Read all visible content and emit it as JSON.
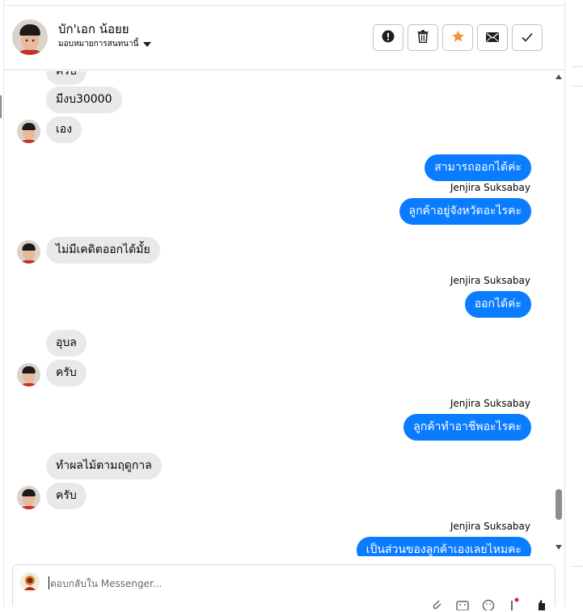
{
  "header": {
    "contact_name": "บัก'เอก น้อยย",
    "assign_label": "มอบหมายการสนทนานี้",
    "actions": [
      {
        "name": "mark-spam",
        "icon": "alert-circle-icon"
      },
      {
        "name": "delete",
        "icon": "trash-icon"
      },
      {
        "name": "star",
        "icon": "star-icon",
        "color": "#f7923a"
      },
      {
        "name": "mark-unread",
        "icon": "envelope-icon"
      },
      {
        "name": "mark-done",
        "icon": "check-icon"
      }
    ]
  },
  "messages": [
    {
      "dir": "in",
      "text": "ครับ"
    },
    {
      "dir": "in",
      "text": "มีงบ30000"
    },
    {
      "dir": "in",
      "text": "เอง"
    },
    {
      "dir": "out",
      "text": "สามารถออกได้ค่ะ"
    },
    {
      "dir": "out",
      "sender": "Jenjira Suksabay",
      "text": "ลูกค้าอยู่จังหวัดอะไรคะ"
    },
    {
      "dir": "in",
      "text": "ไม่มีเคดิตออกได้มั้ย"
    },
    {
      "dir": "out",
      "sender": "Jenjira Suksabay",
      "text": "ออกได้ค่ะ"
    },
    {
      "dir": "in",
      "text": "อุบล"
    },
    {
      "dir": "in",
      "text": "ครับ"
    },
    {
      "dir": "out",
      "sender": "Jenjira Suksabay",
      "text": "ลูกค้าทำอาชีพอะไรคะ"
    },
    {
      "dir": "in",
      "text": "ทำผลไม้ตามฤดูกาล"
    },
    {
      "dir": "in",
      "text": "ครับ"
    },
    {
      "dir": "out",
      "sender": "Jenjira Suksabay",
      "text": "เป็นส่วนของลูกค้าเองเลยไหมคะ"
    }
  ],
  "composer": {
    "placeholder": "ตอบกลับใน Messenger..."
  },
  "colors": {
    "outgoing_bubble": "#0a7cff",
    "incoming_bubble": "#e9e9eb",
    "star": "#f7923a"
  }
}
